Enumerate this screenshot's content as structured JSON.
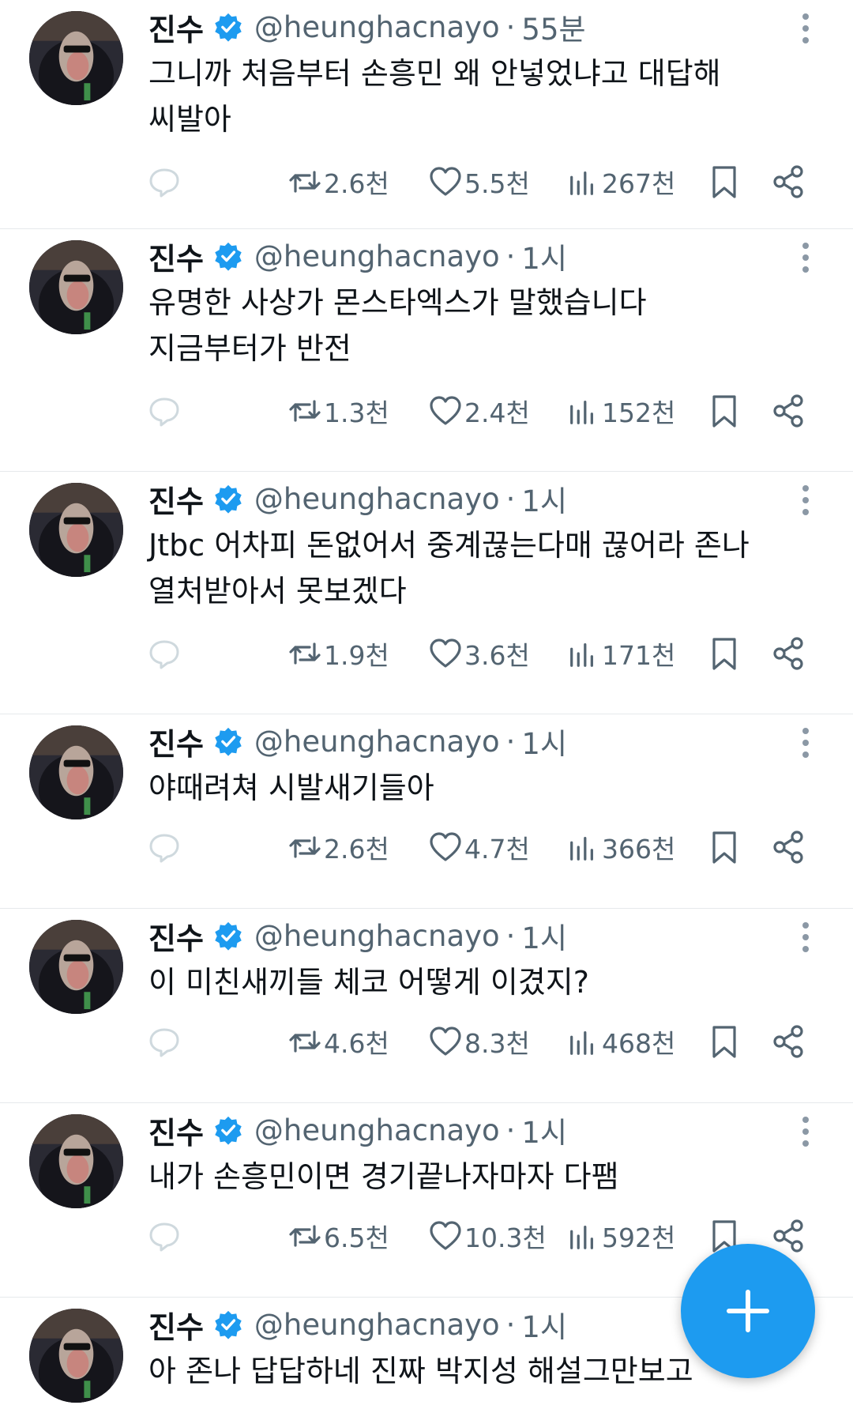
{
  "colors": {
    "accent": "#1d9bf0",
    "text": "#0f1419",
    "muted": "#536471",
    "divider": "#e6e9ec"
  },
  "icons": {
    "verified": "verified-badge-icon",
    "more": "more-vertical-icon",
    "reply": "reply-icon",
    "retweet": "retweet-icon",
    "like": "heart-icon",
    "views": "views-chart-icon",
    "bookmark": "bookmark-icon",
    "share": "share-icon",
    "compose": "plus-icon"
  },
  "tweets": [
    {
      "name": "진수",
      "handle": "@heunghacnayo",
      "separator": "·",
      "time": "55분",
      "lines": [
        "그니까 처음부터 손흥민 왜 안넣었냐고 대답해",
        "씨발아"
      ],
      "retweets": "2.6천",
      "likes": "5.5천",
      "views": "267천"
    },
    {
      "name": "진수",
      "handle": "@heunghacnayo",
      "separator": "·",
      "time": "1시",
      "lines": [
        "유명한 사상가 몬스타엑스가 말했습니다",
        "지금부터가 반전"
      ],
      "retweets": "1.3천",
      "likes": "2.4천",
      "views": "152천"
    },
    {
      "name": "진수",
      "handle": "@heunghacnayo",
      "separator": "·",
      "time": "1시",
      "lines": [
        "Jtbc 어차피 돈없어서 중계끊는다매 끊어라 존나",
        "열처받아서 못보겠다"
      ],
      "retweets": "1.9천",
      "likes": "3.6천",
      "views": "171천"
    },
    {
      "name": "진수",
      "handle": "@heunghacnayo",
      "separator": "·",
      "time": "1시",
      "lines": [
        "야때려쳐 시발새기들아"
      ],
      "retweets": "2.6천",
      "likes": "4.7천",
      "views": "366천"
    },
    {
      "name": "진수",
      "handle": "@heunghacnayo",
      "separator": "·",
      "time": "1시",
      "lines": [
        "이 미친새끼들 체코 어떻게 이겼지?"
      ],
      "retweets": "4.6천",
      "likes": "8.3천",
      "views": "468천"
    },
    {
      "name": "진수",
      "handle": "@heunghacnayo",
      "separator": "·",
      "time": "1시",
      "lines": [
        "내가 손흥민이면 경기끝나자마자 다팸"
      ],
      "retweets": "6.5천",
      "likes": "10.3천",
      "views": "592천"
    },
    {
      "name": "진수",
      "handle": "@heunghacnayo",
      "separator": "·",
      "time": "1시",
      "lines": [
        "아 존나 답답하네 진짜 박지성 해설그만보고"
      ],
      "retweets": "",
      "likes": "",
      "views": ""
    }
  ]
}
